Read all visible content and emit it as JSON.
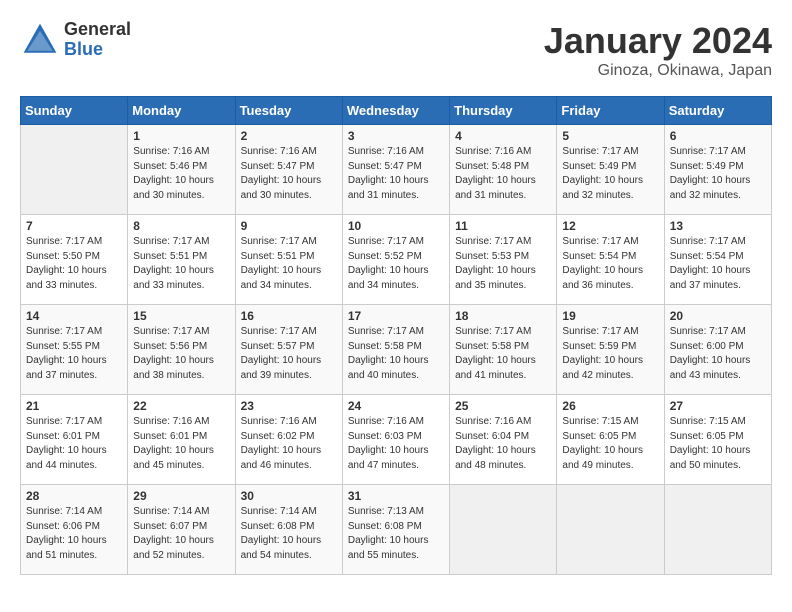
{
  "header": {
    "logo_general": "General",
    "logo_blue": "Blue",
    "month_year": "January 2024",
    "location": "Ginoza, Okinawa, Japan"
  },
  "days_of_week": [
    "Sunday",
    "Monday",
    "Tuesday",
    "Wednesday",
    "Thursday",
    "Friday",
    "Saturday"
  ],
  "weeks": [
    [
      {
        "day": "",
        "content": ""
      },
      {
        "day": "1",
        "content": "Sunrise: 7:16 AM\nSunset: 5:46 PM\nDaylight: 10 hours\nand 30 minutes."
      },
      {
        "day": "2",
        "content": "Sunrise: 7:16 AM\nSunset: 5:47 PM\nDaylight: 10 hours\nand 30 minutes."
      },
      {
        "day": "3",
        "content": "Sunrise: 7:16 AM\nSunset: 5:47 PM\nDaylight: 10 hours\nand 31 minutes."
      },
      {
        "day": "4",
        "content": "Sunrise: 7:16 AM\nSunset: 5:48 PM\nDaylight: 10 hours\nand 31 minutes."
      },
      {
        "day": "5",
        "content": "Sunrise: 7:17 AM\nSunset: 5:49 PM\nDaylight: 10 hours\nand 32 minutes."
      },
      {
        "day": "6",
        "content": "Sunrise: 7:17 AM\nSunset: 5:49 PM\nDaylight: 10 hours\nand 32 minutes."
      }
    ],
    [
      {
        "day": "7",
        "content": "Sunrise: 7:17 AM\nSunset: 5:50 PM\nDaylight: 10 hours\nand 33 minutes."
      },
      {
        "day": "8",
        "content": "Sunrise: 7:17 AM\nSunset: 5:51 PM\nDaylight: 10 hours\nand 33 minutes."
      },
      {
        "day": "9",
        "content": "Sunrise: 7:17 AM\nSunset: 5:51 PM\nDaylight: 10 hours\nand 34 minutes."
      },
      {
        "day": "10",
        "content": "Sunrise: 7:17 AM\nSunset: 5:52 PM\nDaylight: 10 hours\nand 34 minutes."
      },
      {
        "day": "11",
        "content": "Sunrise: 7:17 AM\nSunset: 5:53 PM\nDaylight: 10 hours\nand 35 minutes."
      },
      {
        "day": "12",
        "content": "Sunrise: 7:17 AM\nSunset: 5:54 PM\nDaylight: 10 hours\nand 36 minutes."
      },
      {
        "day": "13",
        "content": "Sunrise: 7:17 AM\nSunset: 5:54 PM\nDaylight: 10 hours\nand 37 minutes."
      }
    ],
    [
      {
        "day": "14",
        "content": "Sunrise: 7:17 AM\nSunset: 5:55 PM\nDaylight: 10 hours\nand 37 minutes."
      },
      {
        "day": "15",
        "content": "Sunrise: 7:17 AM\nSunset: 5:56 PM\nDaylight: 10 hours\nand 38 minutes."
      },
      {
        "day": "16",
        "content": "Sunrise: 7:17 AM\nSunset: 5:57 PM\nDaylight: 10 hours\nand 39 minutes."
      },
      {
        "day": "17",
        "content": "Sunrise: 7:17 AM\nSunset: 5:58 PM\nDaylight: 10 hours\nand 40 minutes."
      },
      {
        "day": "18",
        "content": "Sunrise: 7:17 AM\nSunset: 5:58 PM\nDaylight: 10 hours\nand 41 minutes."
      },
      {
        "day": "19",
        "content": "Sunrise: 7:17 AM\nSunset: 5:59 PM\nDaylight: 10 hours\nand 42 minutes."
      },
      {
        "day": "20",
        "content": "Sunrise: 7:17 AM\nSunset: 6:00 PM\nDaylight: 10 hours\nand 43 minutes."
      }
    ],
    [
      {
        "day": "21",
        "content": "Sunrise: 7:17 AM\nSunset: 6:01 PM\nDaylight: 10 hours\nand 44 minutes."
      },
      {
        "day": "22",
        "content": "Sunrise: 7:16 AM\nSunset: 6:01 PM\nDaylight: 10 hours\nand 45 minutes."
      },
      {
        "day": "23",
        "content": "Sunrise: 7:16 AM\nSunset: 6:02 PM\nDaylight: 10 hours\nand 46 minutes."
      },
      {
        "day": "24",
        "content": "Sunrise: 7:16 AM\nSunset: 6:03 PM\nDaylight: 10 hours\nand 47 minutes."
      },
      {
        "day": "25",
        "content": "Sunrise: 7:16 AM\nSunset: 6:04 PM\nDaylight: 10 hours\nand 48 minutes."
      },
      {
        "day": "26",
        "content": "Sunrise: 7:15 AM\nSunset: 6:05 PM\nDaylight: 10 hours\nand 49 minutes."
      },
      {
        "day": "27",
        "content": "Sunrise: 7:15 AM\nSunset: 6:05 PM\nDaylight: 10 hours\nand 50 minutes."
      }
    ],
    [
      {
        "day": "28",
        "content": "Sunrise: 7:14 AM\nSunset: 6:06 PM\nDaylight: 10 hours\nand 51 minutes."
      },
      {
        "day": "29",
        "content": "Sunrise: 7:14 AM\nSunset: 6:07 PM\nDaylight: 10 hours\nand 52 minutes."
      },
      {
        "day": "30",
        "content": "Sunrise: 7:14 AM\nSunset: 6:08 PM\nDaylight: 10 hours\nand 54 minutes."
      },
      {
        "day": "31",
        "content": "Sunrise: 7:13 AM\nSunset: 6:08 PM\nDaylight: 10 hours\nand 55 minutes."
      },
      {
        "day": "",
        "content": ""
      },
      {
        "day": "",
        "content": ""
      },
      {
        "day": "",
        "content": ""
      }
    ]
  ]
}
